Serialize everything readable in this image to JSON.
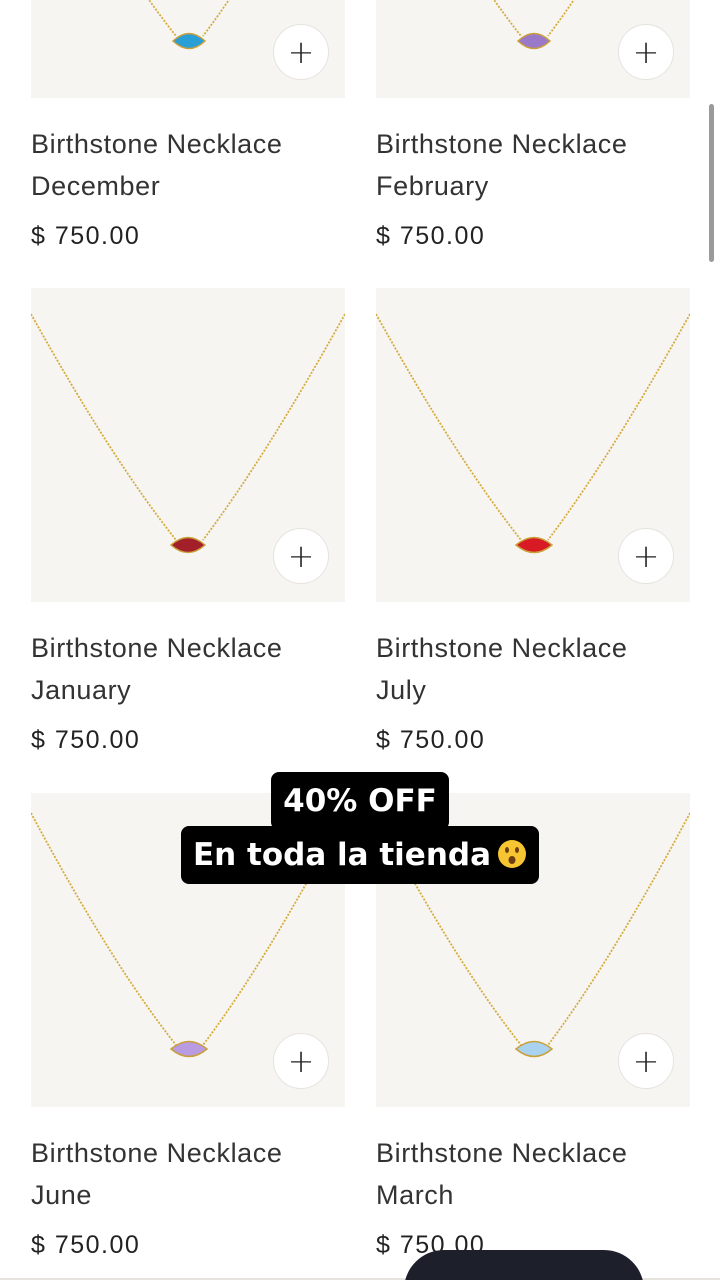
{
  "products": [
    {
      "name_line1": "Birthstone Necklace",
      "name_line2": "December",
      "price": "$ 750.00",
      "stone_color": "#2a9fd6",
      "add_label": "+"
    },
    {
      "name_line1": "Birthstone Necklace",
      "name_line2": "February",
      "price": "$ 750.00",
      "stone_color": "#9b79c9",
      "add_label": "+"
    },
    {
      "name_line1": "Birthstone Necklace",
      "name_line2": "January",
      "price": "$ 750.00",
      "stone_color": "#a3202a",
      "add_label": "+"
    },
    {
      "name_line1": "Birthstone Necklace",
      "name_line2": "July",
      "price": "$ 750.00",
      "stone_color": "#d81a24",
      "add_label": "+"
    },
    {
      "name_line1": "Birthstone Necklace",
      "name_line2": "June",
      "price": "$ 750.00",
      "stone_color": "#b89be0",
      "add_label": "+"
    },
    {
      "name_line1": "Birthstone Necklace",
      "name_line2": "March",
      "price": "$ 750.00",
      "stone_color": "#a9d2ee",
      "add_label": "+"
    }
  ],
  "promo": {
    "line1": "40% OFF",
    "line2": "En toda la tienda",
    "emoji": "hushed-face-emoji"
  },
  "colors": {
    "image_bg": "#f7f5f2",
    "chain": "#d4ac3c",
    "promo_bg": "#000000",
    "promo_text": "#ffffff"
  }
}
